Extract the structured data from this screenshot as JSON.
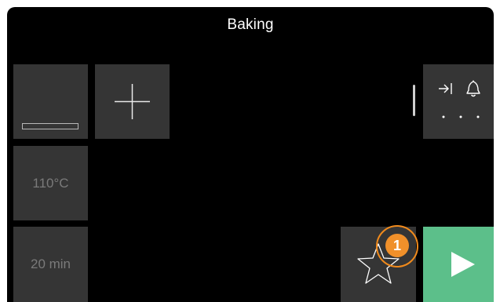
{
  "header": {
    "title": "Baking"
  },
  "tiles": {
    "rack": {
      "icon": "oven-rack-icon"
    },
    "add": {
      "icon": "plus-icon"
    },
    "temperature": {
      "value": "110°C"
    },
    "duration": {
      "value": "20 min"
    },
    "options": {
      "icons": [
        "skip-to-end-icon",
        "bell-icon",
        "more-dots-icon"
      ]
    },
    "favorite": {
      "icon": "star-icon"
    },
    "start": {
      "icon": "play-icon"
    }
  },
  "overlay": {
    "badge_number": "1"
  },
  "colors": {
    "background": "#000000",
    "tile": "#353535",
    "start": "#5cbf8a",
    "badge": "#f0902a"
  }
}
